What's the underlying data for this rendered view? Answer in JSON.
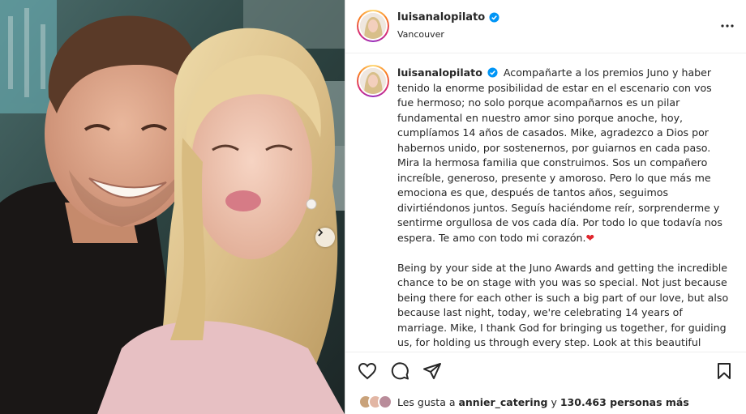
{
  "post": {
    "username": "luisanalopilato",
    "location": "Vancouver",
    "caption_es": "Acompañarte a los premios Juno y haber tenido la enorme posibilidad de estar en el escenario con vos fue hermoso; no solo porque acompañarnos es un pilar fundamental en nuestro amor sino porque anoche, hoy, cumplíamos 14 años de casados. Mike, agradezco a Dios por habernos unido, por sostenernos, por guiarnos en cada paso. Mira la hermosa familia que construimos. Sos un compañero increíble, generoso, presente y amoroso. Pero lo que más me emociona es que, después de tantos años, seguimos divirtiéndonos juntos. Seguís haciéndome reír, sorprenderme y sentirme orgullosa de vos cada día. Por todo lo que todavía nos espera. Te amo con todo mi corazón.",
    "caption_heart": "❤",
    "caption_en": "Being by your side at the Juno Awards and getting the incredible chance to be on stage with you was so special. Not just because being there for each other is such a big part of our love, but also because last night, today, we're celebrating 14 years of marriage. Mike, I thank God for bringing us together, for guiding us, for holding us through every step. Look at this beautiful family we've built. You're an amazing partner — kind, generous, present, and full of love.",
    "likes_prefix": "Les gusta a",
    "likes_user": "annier_catering",
    "likes_joiner": "y",
    "likes_count": "130.463 personas más"
  },
  "icons": {
    "verified": "verified-badge-icon",
    "more": "more-options-icon",
    "like": "heart-icon",
    "comment": "comment-icon",
    "share": "share-icon",
    "save": "bookmark-icon",
    "next": "chevron-right-icon"
  },
  "colors": {
    "verified": "#0095f6",
    "heart": "#e0272e",
    "text": "#262626"
  }
}
